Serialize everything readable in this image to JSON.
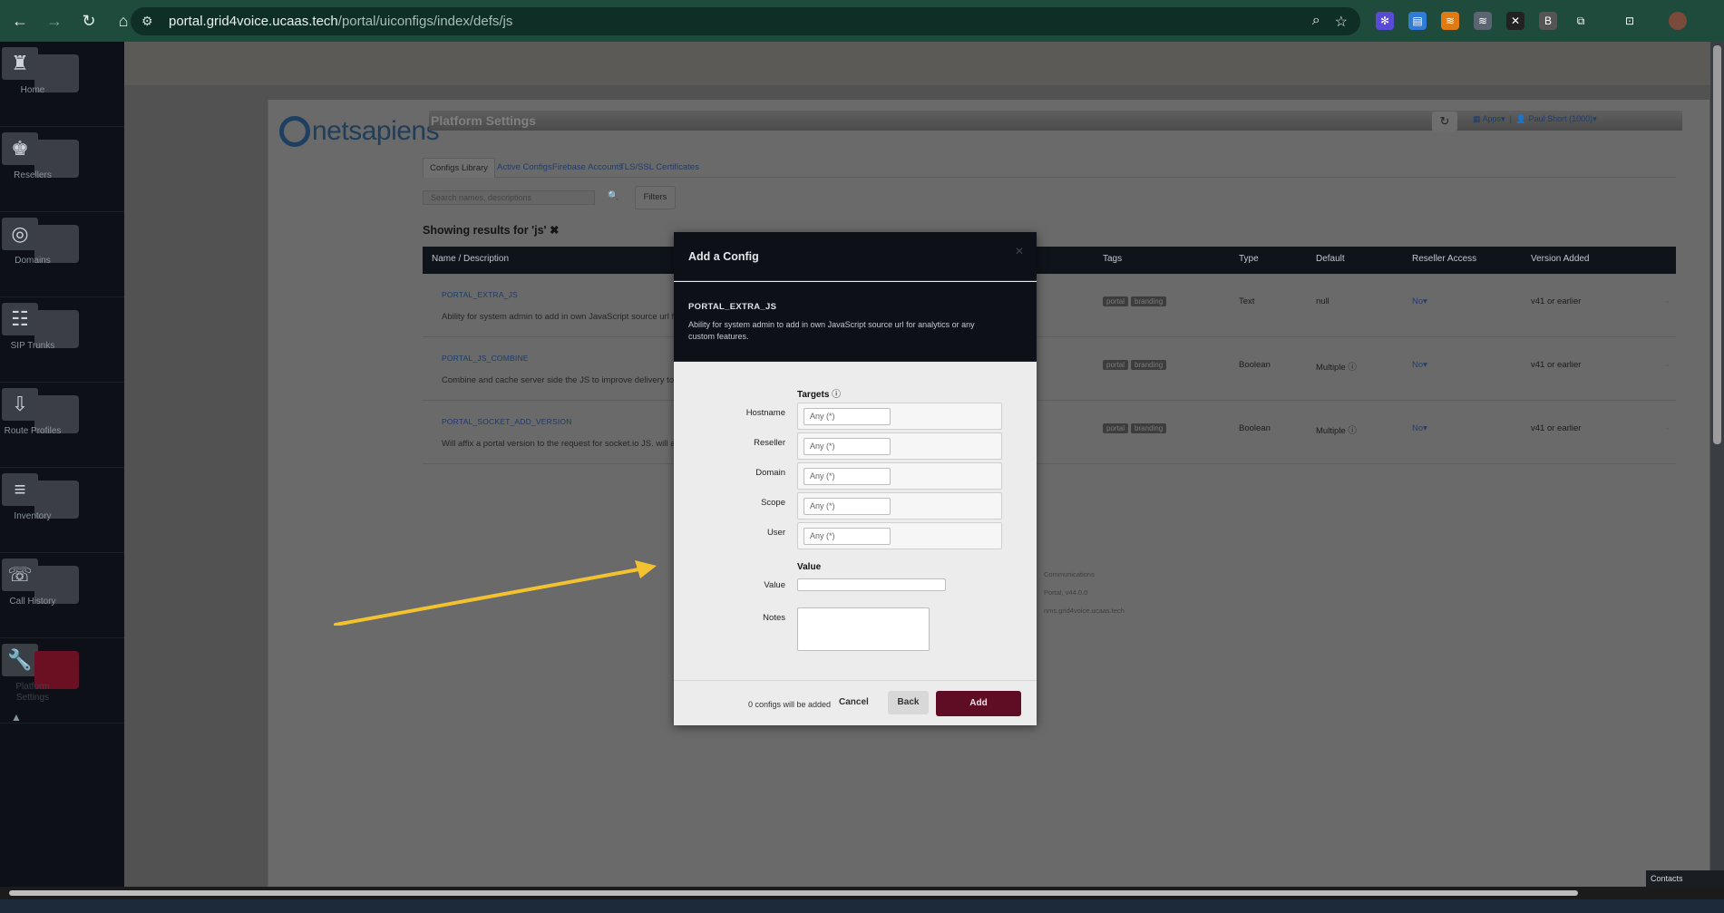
{
  "browser": {
    "url_host": "portal.grid4voice.ucaas.tech",
    "url_path": "/portal/uiconfigs/index/defs/js"
  },
  "sidebar": {
    "items": [
      {
        "label": "Home",
        "icon": "home-icon"
      },
      {
        "label": "Resellers",
        "icon": "resellers-icon"
      },
      {
        "label": "Domains",
        "icon": "domains-icon"
      },
      {
        "label": "SIP Trunks",
        "icon": "sip-trunks-icon"
      },
      {
        "label": "Route Profiles",
        "icon": "route-profiles-icon"
      },
      {
        "label": "Inventory",
        "icon": "inventory-icon"
      },
      {
        "label": "Call History",
        "icon": "call-history-icon"
      },
      {
        "label": "Platform Settings",
        "icon": "wrench-icon"
      }
    ]
  },
  "header": {
    "logo_text": "netsapiens",
    "page_title": "Platform Settings",
    "apps_label": "Apps",
    "user_label": "Paul Short (1000)"
  },
  "tabs": [
    "Configs Library",
    "Active Configs",
    "Firebase Accounts",
    "TLS/SSL Certificates"
  ],
  "search": {
    "placeholder": "Search names, descriptions",
    "filters_label": "Filters"
  },
  "results_label": "Showing results for 'js'",
  "table": {
    "headers": [
      "Name / Description",
      "Tags",
      "Type",
      "Default",
      "Reseller Access",
      "Version Added"
    ],
    "rows": [
      {
        "name": "PORTAL_EXTRA_JS",
        "desc": "Ability for system admin to add in own JavaScript source url f",
        "tags": [
          "portal",
          "branding"
        ],
        "type": "Text",
        "default": "null",
        "access": "No",
        "version": "v41 or earlier"
      },
      {
        "name": "PORTAL_JS_COMBINE",
        "desc": "Combine and cache server side the JS to improve delivery to t",
        "tags": [
          "portal",
          "branding"
        ],
        "type": "Boolean",
        "default": "Multiple",
        "access": "No",
        "version": "v41 or earlier"
      },
      {
        "name": "PORTAL_SOCKET_ADD_VERSION",
        "desc": "Will affix a portal version to the request for socket.io JS. will a",
        "tags": [
          "portal",
          "branding"
        ],
        "type": "Boolean",
        "default": "Multiple",
        "access": "No",
        "version": "v41 or earlier"
      }
    ]
  },
  "footer_lines": [
    "Communications",
    "Portal, v44.0.0",
    "nms.grid4voice.ucaas.tech"
  ],
  "modal": {
    "title": "Add a Config",
    "config_name": "PORTAL_EXTRA_JS",
    "config_desc": "Ability for system admin to add in own JavaScript source url for analytics or any custom features.",
    "targets_label": "Targets",
    "fields": [
      {
        "label": "Hostname",
        "placeholder": "Any (*)"
      },
      {
        "label": "Reseller",
        "placeholder": "Any (*)"
      },
      {
        "label": "Domain",
        "placeholder": "Any (*)"
      },
      {
        "label": "Scope",
        "placeholder": "Any (*)"
      },
      {
        "label": "User",
        "placeholder": "Any (*)"
      }
    ],
    "value_section": "Value",
    "value_label": "Value",
    "notes_label": "Notes",
    "count_text": "0 configs will be added",
    "cancel_label": "Cancel",
    "back_label": "Back",
    "add_label": "Add"
  },
  "contacts_label": "Contacts",
  "colors": {
    "chrome": "#1f4b3d",
    "sidebar": "#0d1117",
    "add_button": "#5e0d24",
    "arrow": "#f2c230"
  }
}
